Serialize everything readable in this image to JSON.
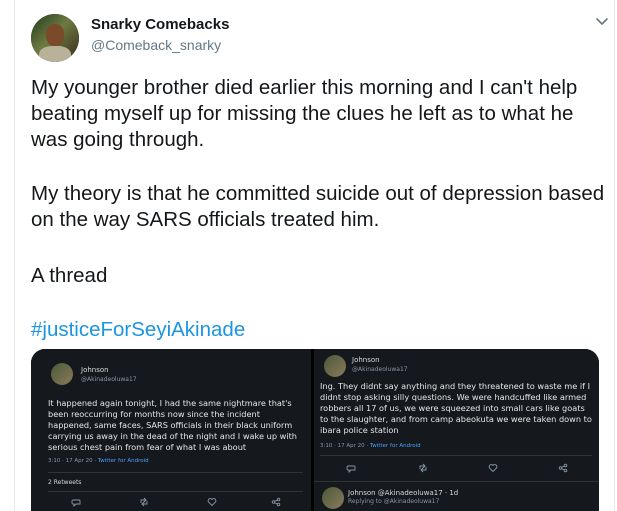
{
  "author": {
    "name": "Snarky Comebacks",
    "handle": "@Comeback_snarky"
  },
  "tweet": {
    "paragraph1": "My younger brother died earlier this morning and I can't help beating myself up for missing the clues he left as to what he was going through.",
    "paragraph2": "My theory is that he committed suicide out of depression based on the way SARS officials treated him.",
    "paragraph3": "A thread",
    "hashtag": "#justiceForSeyiAkinade"
  },
  "media": {
    "left": {
      "name": "Johnson",
      "handle": "@Akinadeoluwa17",
      "body": "It happened again tonight, I had the same nightmare that's been reoccurring for months now since the incident happened, same faces, SARS officials in their black uniform carrying us away in the dead of the night and I wake up with serious chest pain from fear of what I was about",
      "meta_time": "3:10 · 17 Apr 20 ·",
      "meta_source": "Twitter for Android",
      "retweets": "2 Retweets"
    },
    "right": {
      "name": "Johnson",
      "handle": "@Akinadeoluwa17",
      "body": "Ing. They didnt say anything and they threatened to waste me if I didnt stop asking silly questions. We were handcuffed like armed robbers all 17 of us, we were squeezed into small cars like goats to the slaughter, and from camp abeokuta we were taken down to ibara police station",
      "meta_time": "3:10 · 17 Apr 20 ·",
      "meta_source": "Twitter for Android",
      "reply_name": "Johnson @Akinadeoluwa17 · 1d",
      "reply_to": "Replying to @Akinadeoluwa17"
    }
  },
  "colors": {
    "text": "#14171a",
    "secondary": "#657786",
    "link": "#1b95e0"
  },
  "icons": {
    "menu": "chevron-down-icon",
    "reply": "reply-icon",
    "retweet": "retweet-icon",
    "like": "heart-icon",
    "share": "share-icon"
  }
}
